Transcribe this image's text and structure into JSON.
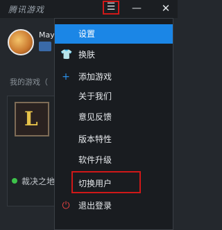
{
  "app": {
    "title": "腾讯游戏"
  },
  "window_controls": {
    "menu": "☰",
    "minimize": "—",
    "close": "✕"
  },
  "profile": {
    "name": "May"
  },
  "games": {
    "section_label": "我的游戏（",
    "current_game": "裁决之地"
  },
  "menu": {
    "items": [
      {
        "label": "设置"
      },
      {
        "label": "换肤"
      },
      {
        "label": "添加游戏"
      },
      {
        "label": "关于我们"
      },
      {
        "label": "意见反馈"
      },
      {
        "label": "版本特性"
      },
      {
        "label": "软件升级"
      },
      {
        "label": "切换用户"
      },
      {
        "label": "退出登录"
      }
    ]
  }
}
